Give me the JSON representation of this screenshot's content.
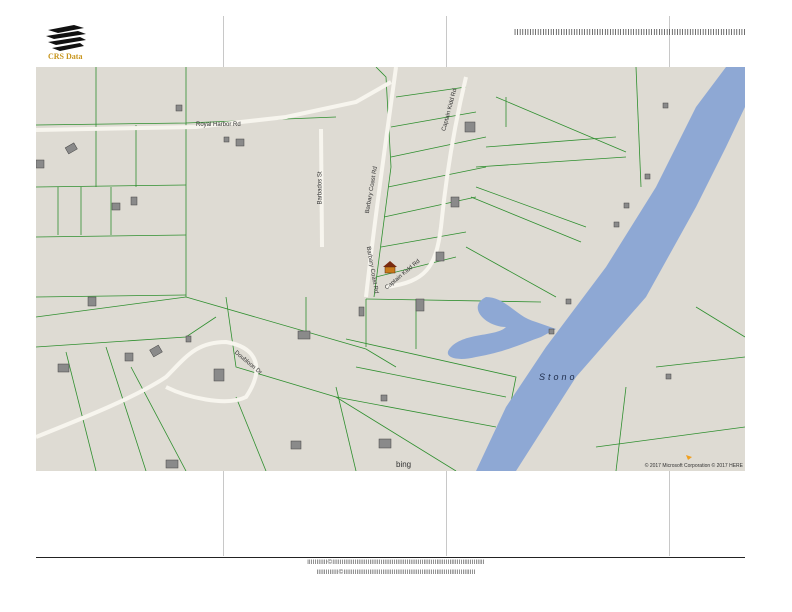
{
  "brand": {
    "name": "CRS Data",
    "accent": "#c8961e"
  },
  "header": {
    "glyph_row": "ǀǀǀǀǀǀǀǀǀǀǀǀǀǀǀǀǀǀǀǀǀǀǀǀǀǀǀǀǀǀǀǀǀǀǀǀǀǀǀǀǀǀǀǀǀǀǀǀǀǀǀǀǀǀǀǀǀǀǀǀǀǀǀǀǀǀǀǀǀǀǀǀǀǀǀǀǀǀǀǀǀǀǀǀǀǀǀǀǀǀ"
  },
  "map": {
    "colors": {
      "land": "#dedbd3",
      "water": "#8ea8d4",
      "parcel": "#2f8f2f",
      "road": "#f7f5ee",
      "building": "#8a8a8a"
    },
    "roads": {
      "royal_harbor": "Royal Harbor Rd",
      "barbados": "Barbados St",
      "barbary_coast_1": "Barbary Coast Rd",
      "barbary_coast_2": "Barbary Coast Rd",
      "captain_kidd_1": "Captain Kidd Rd",
      "captain_kidd_2": "Captain Kidd Rd",
      "doubloon": "Doubloon Dr"
    },
    "water_name": "Stono",
    "attribution": "© 2017 Microsoft Corporation © 2017 HERE",
    "bing_label": "bing",
    "subject_marker_icon": "house-marker-icon"
  },
  "footer": {
    "line1": "ǀǀǀǀǀǀǀǀǀǀǀ©ǀǀǀǀǀǀǀǀǀǀǀǀǀǀǀǀǀǀǀǀǀǀǀǀǀǀǀǀǀǀǀǀǀǀǀǀǀǀǀǀǀǀǀǀǀǀǀǀǀǀǀǀǀǀǀǀǀǀǀǀǀǀǀǀǀǀǀǀǀǀǀǀǀǀǀǀǀǀǀǀǀǀ",
    "line2": "ǀǀǀǀǀǀǀǀǀǀǀǀ©ǀǀǀǀǀǀǀǀǀǀǀǀǀǀǀǀǀǀǀǀǀǀǀǀǀǀǀǀǀǀǀǀǀǀǀǀǀǀǀǀǀǀǀǀǀǀǀǀǀǀǀǀǀǀǀǀǀǀǀǀǀǀǀǀǀǀǀǀǀǀǀ"
  }
}
